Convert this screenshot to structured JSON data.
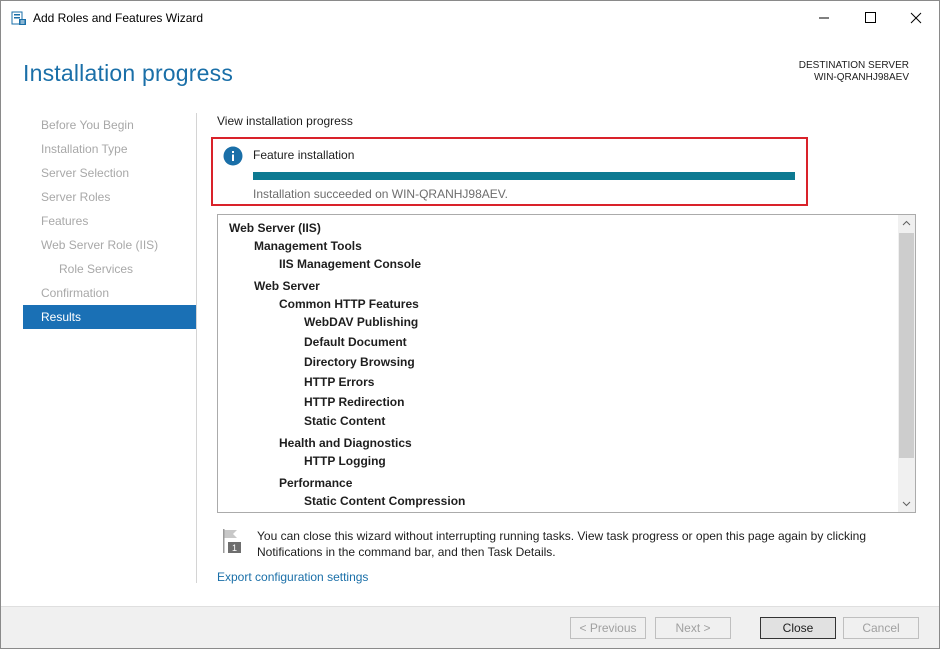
{
  "window": {
    "title": "Add Roles and Features Wizard"
  },
  "header": {
    "page_title": "Installation progress",
    "destination_label": "DESTINATION SERVER",
    "destination_server": "WIN-QRANHJ98AEV"
  },
  "nav": {
    "items": [
      {
        "label": "Before You Begin",
        "state": "disabled",
        "indent": 0
      },
      {
        "label": "Installation Type",
        "state": "disabled",
        "indent": 0
      },
      {
        "label": "Server Selection",
        "state": "disabled",
        "indent": 0
      },
      {
        "label": "Server Roles",
        "state": "disabled",
        "indent": 0
      },
      {
        "label": "Features",
        "state": "disabled",
        "indent": 0
      },
      {
        "label": "Web Server Role (IIS)",
        "state": "disabled",
        "indent": 0
      },
      {
        "label": "Role Services",
        "state": "disabled",
        "indent": 1
      },
      {
        "label": "Confirmation",
        "state": "disabled",
        "indent": 0
      },
      {
        "label": "Results",
        "state": "active",
        "indent": 0
      }
    ]
  },
  "progress": {
    "view_label": "View installation progress",
    "feature_label": "Feature installation",
    "percent_complete": 100,
    "status": "Installation succeeded on WIN-QRANHJ98AEV.",
    "bar_color": "#0d7a92",
    "highlight_color": "#d9222a",
    "info_icon": "info-circle-icon"
  },
  "results": {
    "items": [
      {
        "label": "Web Server (IIS)",
        "level": 0
      },
      {
        "label": "Management Tools",
        "level": 1
      },
      {
        "label": "IIS Management Console",
        "level": 2
      },
      {
        "label": "Web Server",
        "level": 1
      },
      {
        "label": "Common HTTP Features",
        "level": 2
      },
      {
        "label": "WebDAV Publishing",
        "level": 3
      },
      {
        "label": "Default Document",
        "level": 3
      },
      {
        "label": "Directory Browsing",
        "level": 3
      },
      {
        "label": "HTTP Errors",
        "level": 3
      },
      {
        "label": "HTTP Redirection",
        "level": 3
      },
      {
        "label": "Static Content",
        "level": 3
      },
      {
        "label": "Health and Diagnostics",
        "level": 2
      },
      {
        "label": "HTTP Logging",
        "level": 3
      },
      {
        "label": "Performance",
        "level": 2
      },
      {
        "label": "Static Content Compression",
        "level": 3
      }
    ]
  },
  "notice": {
    "line1": "You can close this wizard without interrupting running tasks. View task progress or open this page again by clicking",
    "line2": "Notifications in the command bar, and then Task Details.",
    "flag_badge": "1"
  },
  "links": {
    "export": "Export configuration settings"
  },
  "footer": {
    "previous": "< Previous",
    "next": "Next >",
    "close": "Close",
    "cancel": "Cancel"
  },
  "colors": {
    "accent": "#1a6fa8",
    "nav_active": "#1a70b5"
  }
}
